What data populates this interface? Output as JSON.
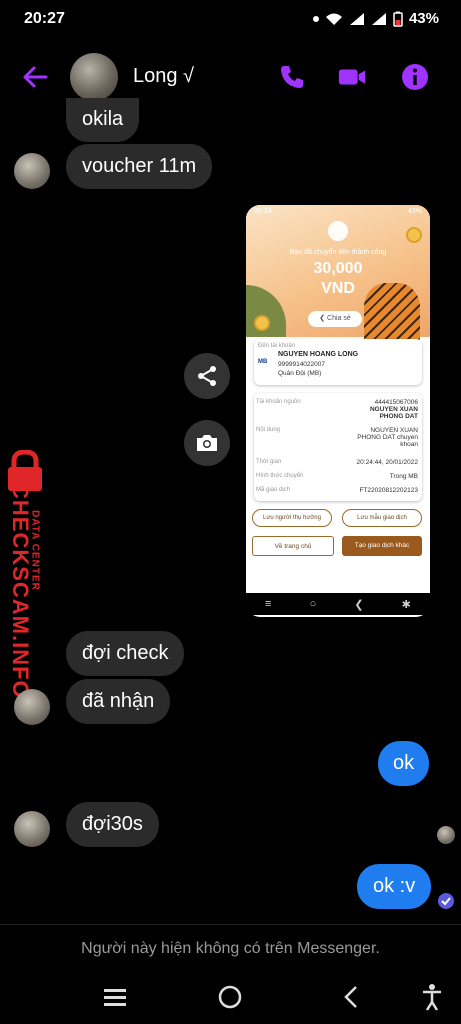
{
  "status": {
    "time": "20:27",
    "battery": "43%"
  },
  "header": {
    "contact_name": "Long √"
  },
  "messages": {
    "okila": "okila",
    "voucher": "voucher 11m",
    "doi_check": "đợi check",
    "da_nhan": "đã nhận",
    "ok": "ok",
    "doi30s": "đợi30s",
    "ok_v": "ok :v"
  },
  "receipt": {
    "status_time": "20:24",
    "status_battery": "43%",
    "subtitle": "Bạn đã chuyển tiền thành công",
    "amount": "30,000",
    "currency": "VND",
    "share": "Chia sẻ",
    "to_label": "Đến tài khoản",
    "bank_short": "MB",
    "recipient_name": "NGUYEN HOANG LONG",
    "recipient_account": "9999914022007",
    "recipient_bank": "Quân Đội (MB)",
    "source_label": "Tài khoản nguồn",
    "source_account": "444415067006",
    "source_name": "NGUYEN XUAN PHONG DAT",
    "content_label": "Nội dung",
    "content_value": "NGUYEN XUAN PHONG DAT chuyen khoan",
    "time_label": "Thời gian",
    "time_value": "20:24:44, 20/01/2022",
    "method_label": "Hình thức chuyển",
    "method_value": "Trong MB",
    "tx_label": "Mã giao dịch",
    "tx_value": "FT22020812202123",
    "save_contact": "Lưu người thụ hưởng",
    "save_template": "Lưu mẫu giao dịch",
    "home": "Về trang chủ",
    "new_tx": "Tạo giao dịch khác"
  },
  "watermark": {
    "brand": "CHECKSCAM.INFO",
    "sub": "DATA CENTER"
  },
  "footer": {
    "notice": "Người này hiện không có trên Messenger."
  },
  "colors": {
    "accent": "#a033ff",
    "bubble_out": "#1f7df0",
    "bubble_in": "#2b2b2b",
    "watermark": "#e1262a"
  }
}
